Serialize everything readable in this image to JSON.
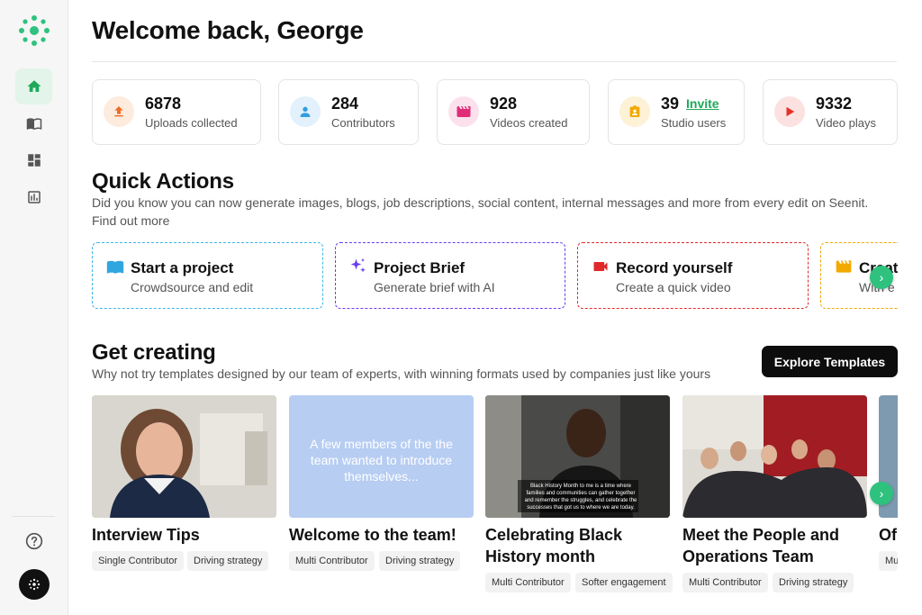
{
  "page": {
    "title": "Welcome back, George"
  },
  "stats": [
    {
      "value": "6878",
      "label": "Uploads collected",
      "icon": "upload-icon",
      "color": "#f26b22",
      "bg": "#fdebdd"
    },
    {
      "value": "284",
      "label": "Contributors",
      "icon": "person-icon",
      "color": "#2f9fe0",
      "bg": "#e2f1fb"
    },
    {
      "value": "928",
      "label": "Videos created",
      "icon": "clapperboard-icon",
      "color": "#e02d77",
      "bg": "#fbe1ec"
    },
    {
      "value": "39",
      "label": "Studio users",
      "icon": "badge-icon",
      "color": "#f2a900",
      "bg": "#fdf1d6",
      "link": "Invite"
    },
    {
      "value": "9332",
      "label": "Video plays",
      "icon": "play-icon",
      "color": "#e4322b",
      "bg": "#fbe2e1"
    }
  ],
  "quick_actions": {
    "title": "Quick Actions",
    "description": "Did you know you can now generate images, blogs, job descriptions, social content, internal messages and more from every edit on Seenit. Find out more",
    "items": [
      {
        "title": "Start a project",
        "subtitle": "Crowdsource and edit",
        "icon": "book-icon",
        "color": "#2fa6e0"
      },
      {
        "title": "Project Brief",
        "subtitle": "Generate brief with AI",
        "icon": "sparkle-icon",
        "color": "#6a3df0"
      },
      {
        "title": "Record yourself",
        "subtitle": "Create a quick video",
        "icon": "video-camera-icon",
        "color": "#e0292a"
      },
      {
        "title": "Create",
        "subtitle": "With e",
        "icon": "clapperboard-icon",
        "color": "#f2a900"
      }
    ]
  },
  "get_creating": {
    "title": "Get creating",
    "description": "Why not try templates designed by our team of experts, with winning formats used by companies just like yours",
    "explore_label": "Explore Templates",
    "templates": [
      {
        "title": "Interview Tips",
        "tags": [
          "Single Contributor",
          "Driving strategy"
        ]
      },
      {
        "title": "Welcome to the team!",
        "tags": [
          "Multi Contributor",
          "Driving strategy"
        ],
        "thumb_text": "A few members of the the team wanted to introduce themselves..."
      },
      {
        "title": "Celebrating Black History month",
        "tags": [
          "Multi Contributor",
          "Softer engagement"
        ],
        "thumb_caption": "Black History Month to me is a time where families and communities can gather together and remember the struggles, and celebrate the successes that got us to where we are today."
      },
      {
        "title": "Meet the People and Operations Team",
        "tags": [
          "Multi Contributor",
          "Driving strategy"
        ]
      },
      {
        "title": "Of",
        "tags": [
          "Mu"
        ]
      }
    ]
  }
}
